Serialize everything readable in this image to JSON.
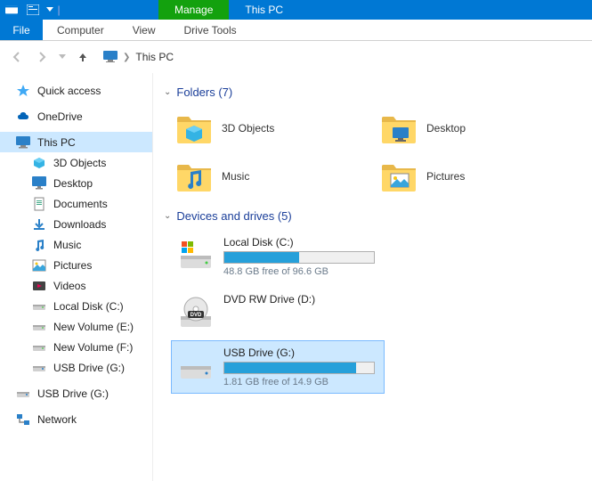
{
  "titlebar": {
    "manage_tab": "Manage",
    "window_title": "This PC"
  },
  "ribbon": {
    "file": "File",
    "tabs": [
      "Computer",
      "View"
    ],
    "context_tab": "Drive Tools"
  },
  "nav": {
    "location": "This PC"
  },
  "sidebar": {
    "items": [
      {
        "label": "Quick access",
        "icon": "star",
        "child": false
      },
      {
        "label": "OneDrive",
        "icon": "cloud",
        "child": false
      },
      {
        "label": "This PC",
        "icon": "pc",
        "child": false,
        "selected": true
      },
      {
        "label": "3D Objects",
        "icon": "3d",
        "child": true
      },
      {
        "label": "Desktop",
        "icon": "desktop",
        "child": true
      },
      {
        "label": "Documents",
        "icon": "doc",
        "child": true
      },
      {
        "label": "Downloads",
        "icon": "down",
        "child": true
      },
      {
        "label": "Music",
        "icon": "music",
        "child": true
      },
      {
        "label": "Pictures",
        "icon": "pic",
        "child": true
      },
      {
        "label": "Videos",
        "icon": "video",
        "child": true
      },
      {
        "label": "Local Disk (C:)",
        "icon": "disk",
        "child": true
      },
      {
        "label": "New Volume (E:)",
        "icon": "disk",
        "child": true
      },
      {
        "label": "New Volume (F:)",
        "icon": "disk",
        "child": true
      },
      {
        "label": "USB Drive (G:)",
        "icon": "usb",
        "child": true
      },
      {
        "label": "USB Drive (G:)",
        "icon": "usb",
        "child": false
      },
      {
        "label": "Network",
        "icon": "net",
        "child": false
      }
    ]
  },
  "main": {
    "folders_header": "Folders (7)",
    "folders": [
      {
        "label": "3D Objects",
        "icon": "3d"
      },
      {
        "label": "Desktop",
        "icon": "desktop"
      },
      {
        "label": "Music",
        "icon": "music"
      },
      {
        "label": "Pictures",
        "icon": "pic"
      }
    ],
    "drives_header": "Devices and drives (5)",
    "drives": [
      {
        "name": "Local Disk (C:)",
        "free": "48.8 GB free of 96.6 GB",
        "fill_pct": 50,
        "icon": "windisk"
      },
      {
        "name": "DVD RW Drive (D:)",
        "free": "",
        "fill_pct": null,
        "icon": "dvd"
      },
      {
        "name": "USB Drive (G:)",
        "free": "1.81 GB free of 14.9 GB",
        "fill_pct": 88,
        "icon": "usb",
        "selected": true
      }
    ]
  }
}
